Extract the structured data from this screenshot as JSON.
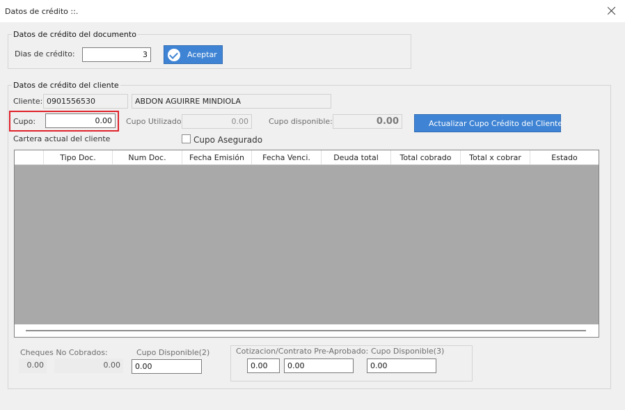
{
  "window": {
    "title": "Datos de crédito ::."
  },
  "documento": {
    "legend": "Datos de crédito del documento",
    "dias_label": "Dias de crédito:",
    "dias_value": "3",
    "aceptar_label": "Aceptar"
  },
  "cliente": {
    "legend": "Datos de crédito del cliente",
    "cliente_label": "Cliente:",
    "cliente_id": "0901556530",
    "cliente_nombre": "ABDON AGUIRRE MINDIOLA",
    "cupo_label": "Cupo:",
    "cupo_value": "0.00",
    "cupo_utilizado_label": "Cupo Utilizado:",
    "cupo_utilizado_value": "0.00",
    "cupo_disponible_label": "Cupo disponible:",
    "cupo_disponible_value": "0.00",
    "actualizar_label": "Actualizar Cupo Crédito del Cliente",
    "cupo_asegurado_label": "Cupo Asegurado",
    "cartera_label": "Cartera actual del cliente"
  },
  "grid": {
    "columns": [
      "",
      "Tipo Doc.",
      "Num Doc.",
      "Fecha Emisión",
      "Fecha Venci.",
      "Deuda total",
      "Total cobrado",
      "Total x cobrar",
      "Estado"
    ]
  },
  "footer": {
    "cheques_label": "Cheques No Cobrados:",
    "cheques_count": "0.00",
    "cheques_value": "0.00",
    "cupo_disp2_label": "Cupo Disponible(2)",
    "cupo_disp2_value": "0.00",
    "cotizacion_label": "Cotizacion/Contrato Pre-Aprobado:",
    "cotizacion_count": "0.00",
    "cotizacion_value": "0.00",
    "cupo_disp3_label": "Cupo Disponible(3)",
    "cupo_disp3_value": "0.00"
  },
  "colors": {
    "accent": "#3f84d4",
    "highlight": "#e0222b",
    "grid_empty": "#a9a9a9"
  }
}
